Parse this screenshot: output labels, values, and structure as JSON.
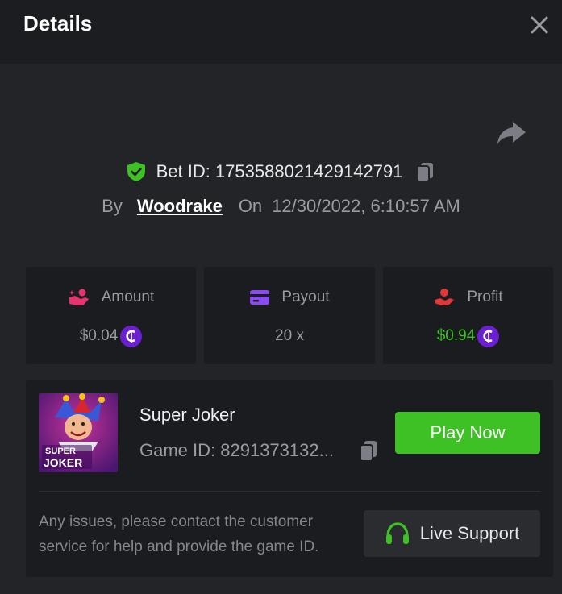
{
  "header": {
    "title": "Details"
  },
  "bet": {
    "id_label": "Bet ID: 1753588021429142791",
    "by_label": "By",
    "user": "Woodrake",
    "on_label": "On",
    "datetime": "12/30/2022, 6:10:57 AM"
  },
  "stats": {
    "amount": {
      "label": "Amount",
      "value": "$0.04"
    },
    "payout": {
      "label": "Payout",
      "value": "20 x"
    },
    "profit": {
      "label": "Profit",
      "value": "$0.94"
    }
  },
  "game": {
    "name": "Super Joker",
    "id_label": "Game ID: 8291373132...",
    "thumb_text_1": "SUPER",
    "thumb_text_2": "JOKER",
    "play_label": "Play Now",
    "help_text": "Any issues, please contact the customer service for help and provide the game ID.",
    "support_label": "Live Support"
  },
  "colors": {
    "accent_green": "#3ec124",
    "coin_purple": "#6a1fd0",
    "amount_icon": "#e8336e",
    "payout_icon": "#8a4bf0",
    "profit_icon": "#e0383a"
  },
  "icons": [
    "close-icon",
    "share-icon",
    "shield-check-icon",
    "copy-icon",
    "coins-hand-icon",
    "card-icon",
    "hand-user-icon",
    "coin-icon",
    "headset-icon"
  ]
}
